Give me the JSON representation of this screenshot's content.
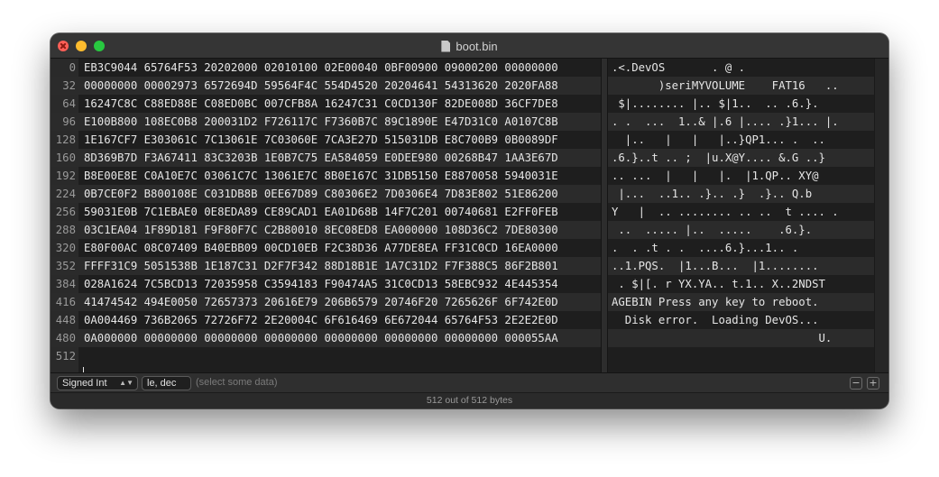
{
  "window": {
    "title": "boot.bin"
  },
  "offsets": [
    "0",
    "32",
    "64",
    "96",
    "128",
    "160",
    "192",
    "224",
    "256",
    "288",
    "320",
    "352",
    "384",
    "416",
    "448",
    "480",
    "512"
  ],
  "hex_rows": [
    "EB3C9044 65764F53 20202000 02010100 02E00040 0BF00900 09000200 00000000",
    "00000000 00002973 6572694D 59564F4C 554D4520 20204641 54313620 2020FA88",
    "16247C8C C88ED88E C08ED0BC 007CFB8A 16247C31 C0CD130F 82DE008D 36CF7DE8",
    "E100B800 108EC0B8 200031D2 F726117C F7360B7C 89C1890E E47D31C0 A0107C8B",
    "1E167CF7 E303061C 7C13061E 7C03060E 7CA3E27D 515031DB E8C700B9 0B0089DF",
    "8D369B7D F3A67411 83C3203B 1E0B7C75 EA584059 E0DEE980 00268B47 1AA3E67D",
    "B8E00E8E C0A10E7C 03061C7C 13061E7C 8B0E167C 31DB5150 E8870058 5940031E",
    "0B7CE0F2 B800108E C031DB8B 0EE67D89 C80306E2 7D0306E4 7D83E802 51E86200",
    "59031E0B 7C1EBAE0 0E8EDA89 CE89CAD1 EA01D68B 14F7C201 00740681 E2FF0FEB",
    "03C1EA04 1F89D181 F9F80F7C C2B80010 8EC08ED8 EA000000 108D36C2 7DE80300",
    "E80F00AC 08C07409 B40EBB09 00CD10EB F2C38D36 A77DE8EA FF31C0CD 16EA0000",
    "FFFF31C9 5051538B 1E187C31 D2F7F342 88D18B1E 1A7C31D2 F7F388C5 86F2B801",
    "028A1624 7C5BCD13 72035958 C3594183 F90474A5 31C0CD13 58EBC932 4E445354",
    "41474542 494E0050 72657373 20616E79 206B6579 20746F20 7265626F 6F742E0D",
    "0A004469 736B2065 72726F72 2E20004C 6F616469 6E672044 65764F53 2E2E2E0D",
    "0A000000 00000000 00000000 00000000 00000000 00000000 00000000 000055AA"
  ],
  "ascii_rows": [
    ".<.DevOS       . @ .",
    "       )seriMYVOLUME    FAT16   ..",
    " $|........ |.. $|1..  .. .6.}.",
    ". .  ...  1..& |.6 |.... .}1... |.",
    "  |..   |   |   |..}QP1... .  ..",
    ".6.}..t .. ;  |u.X@Y.... &.G ..}",
    ".. ...  |   |   |.  |1.QP.. XY@",
    " |...  ..1.. .}.. .}  .}.. Q.b",
    "Y   |  .. ........ .. ..  t .... .",
    " ..  ..... |..  .....    .6.}.",
    ".  . .t . .  ....6.}...1.. .",
    "..1.PQS.  |1...B...  |1........",
    " . $|[. r YX.YA.. t.1.. X..2NDST",
    "AGEBIN Press any key to reboot.",
    "  Disk error.  Loading DevOS...",
    "                               U."
  ],
  "inspector": {
    "type_value": "Signed Int",
    "endian_value": "le, dec",
    "placeholder": "(select some data)"
  },
  "status": {
    "text": "512 out of 512 bytes"
  }
}
